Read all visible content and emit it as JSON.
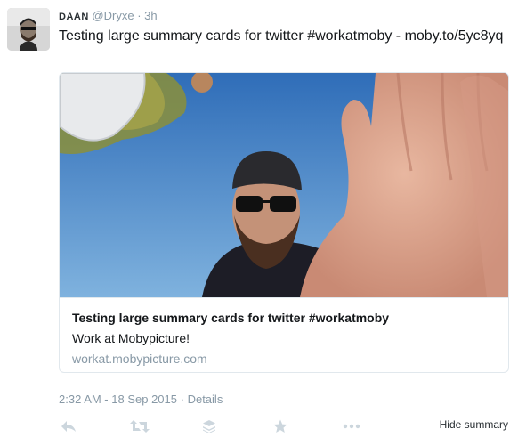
{
  "tweet": {
    "author_name": "DAAN",
    "handle": "@Dryxe",
    "separator": "·",
    "time": "3h",
    "text": "Testing large summary cards for twitter #workatmoby - moby.to/5yc8yq"
  },
  "card": {
    "title": "Testing large summary cards for twitter #workatmoby",
    "description": "Work at Mobypicture!",
    "domain": "workat.mobypicture.com"
  },
  "meta": {
    "timestamp": "2:32 AM - 18 Sep 2015",
    "separator": "·",
    "details_label": "Details"
  },
  "actions": {
    "icons": [
      "reply-icon",
      "retweet-icon",
      "buffer-icon",
      "favorite-icon",
      "more-icon"
    ],
    "hide_summary_label": "Hide summary"
  },
  "colors": {
    "muted": "#8899a6",
    "text": "#14171a",
    "border": "#e1e8ed",
    "action_icon": "#ccd6dd"
  }
}
